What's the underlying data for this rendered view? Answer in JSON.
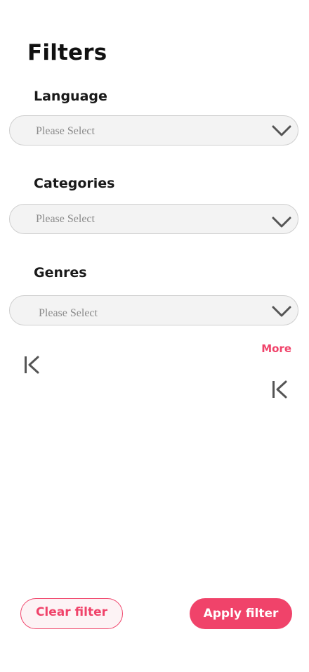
{
  "page": {
    "title": "Filters"
  },
  "filters": {
    "language": {
      "label": "Language",
      "placeholder": "Please Select"
    },
    "categories": {
      "label": "Categories",
      "placeholder": "Please Select"
    },
    "genres": {
      "label": "Genres",
      "placeholder": "Please Select"
    }
  },
  "more_label": "More",
  "icons": {
    "chevron": "chevron-down-icon",
    "skip": "skip-previous-icon"
  },
  "colors": {
    "accent": "#f0436a",
    "select_bg": "#f3f3f3",
    "select_border": "#cfcfcf",
    "placeholder": "#8a8a8a",
    "icon": "#555555"
  },
  "actions": {
    "clear_label": "Clear filter",
    "apply_label": "Apply filter"
  }
}
